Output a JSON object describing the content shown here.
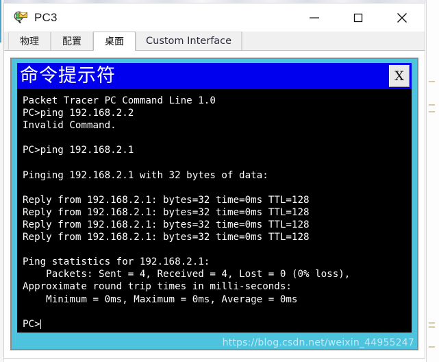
{
  "window": {
    "title": "PC3",
    "icon": "packet-tracer-pc-icon",
    "controls": {
      "minimize_label": "—",
      "maximize_label": "□",
      "close_label": "✕"
    }
  },
  "tabs": [
    {
      "label": "物理",
      "id": "physical",
      "active": false,
      "latin": false
    },
    {
      "label": "配置",
      "id": "config",
      "active": false,
      "latin": false
    },
    {
      "label": "桌面",
      "id": "desktop",
      "active": true,
      "latin": false
    },
    {
      "label": "Custom Interface",
      "id": "custom-interface",
      "active": false,
      "latin": true
    }
  ],
  "command_prompt": {
    "title": "命令提示符",
    "close_label": "X",
    "lines": [
      "Packet Tracer PC Command Line 1.0",
      "PC>ping 192.168.2.2",
      "Invalid Command.",
      "",
      "PC>ping 192.168.2.1",
      "",
      "Pinging 192.168.2.1 with 32 bytes of data:",
      "",
      "Reply from 192.168.2.1: bytes=32 time=0ms TTL=128",
      "Reply from 192.168.2.1: bytes=32 time=0ms TTL=128",
      "Reply from 192.168.2.1: bytes=32 time=0ms TTL=128",
      "Reply from 192.168.2.1: bytes=32 time=0ms TTL=128",
      "",
      "Ping statistics for 192.168.2.1:",
      "    Packets: Sent = 4, Received = 4, Lost = 0 (0% loss),",
      "Approximate round trip times in milli-seconds:",
      "    Minimum = 0ms, Maximum = 0ms, Average = 0ms",
      "",
      "PC>"
    ],
    "text": "Packet Tracer PC Command Line 1.0\nPC>ping 192.168.2.2\nInvalid Command.\n\nPC>ping 192.168.2.1\n\nPinging 192.168.2.1 with 32 bytes of data:\n\nReply from 192.168.2.1: bytes=32 time=0ms TTL=128\nReply from 192.168.2.1: bytes=32 time=0ms TTL=128\nReply from 192.168.2.1: bytes=32 time=0ms TTL=128\nReply from 192.168.2.1: bytes=32 time=0ms TTL=128\n\nPing statistics for 192.168.2.1:\n    Packets: Sent = 4, Received = 4, Lost = 0 (0% loss),\nApproximate round trip times in milli-seconds:\n    Minimum = 0ms, Maximum = 0ms, Average = 0ms\n\nPC>"
  },
  "watermark": {
    "text": "https://blog.csdn.net/weixin_44955247"
  },
  "colors": {
    "cmd_titlebar": "#0000ee",
    "cmd_frame": "#4ec3de",
    "terminal_bg": "#000000",
    "terminal_fg": "#ffffff",
    "tab_active_bg": "#ffffff",
    "tab_bg": "#f0f0f0"
  }
}
